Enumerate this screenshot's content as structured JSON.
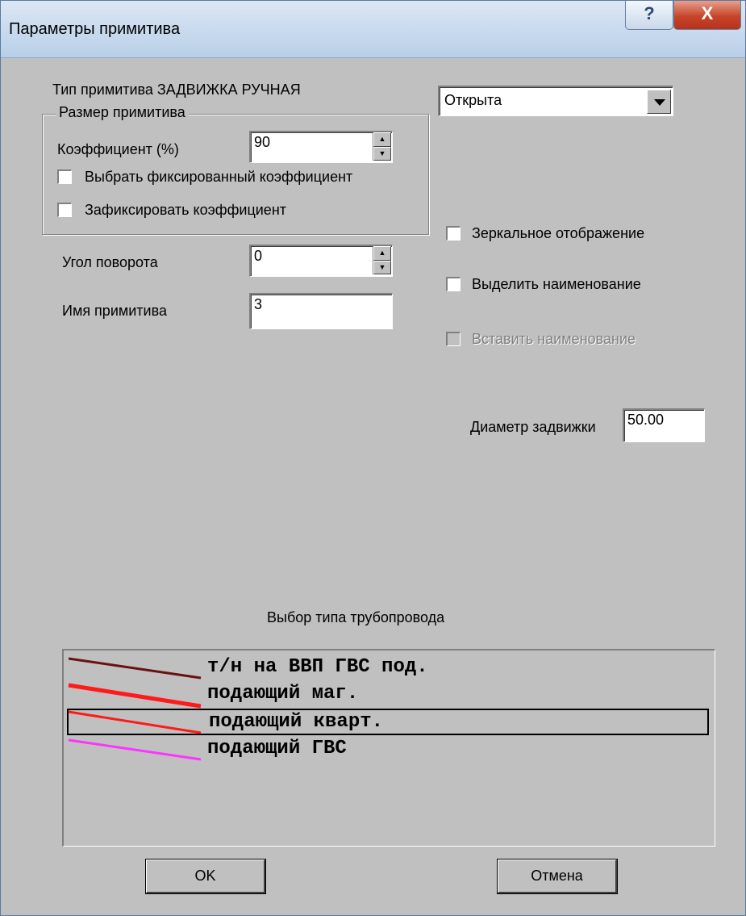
{
  "window": {
    "title": "Параметры примитива",
    "help_glyph": "?",
    "close_glyph": "X"
  },
  "primitive_type": "Тип примитива ЗАДВИЖКА РУЧНАЯ",
  "size_group": {
    "legend": "Размер примитива",
    "coeff_label": "Коэффициент (%)",
    "coeff_value": "90",
    "fixed_choice_label": "Выбрать фиксированный коэффициент",
    "fix_coeff_label": "Зафиксировать коэффициент"
  },
  "rotation": {
    "label": "Угол поворота",
    "value": "0"
  },
  "name": {
    "label": "Имя примитива",
    "value": "3"
  },
  "state_combo": {
    "selected": "Открыта"
  },
  "options": {
    "mirror": "Зеркальное отображение",
    "highlight_name": "Выделить наименование",
    "insert_name": "Вставить наименование"
  },
  "diameter": {
    "label": "Диаметр задвижки",
    "value": "50.00"
  },
  "pipeline": {
    "title": "Выбор типа трубопровода",
    "items": [
      {
        "label": "т/н на ВВП ГВС под.",
        "color": "#6b1010",
        "selected": false
      },
      {
        "label": "подающий маг.",
        "color": "#ff1a1a",
        "selected": false
      },
      {
        "label": "подающий кварт.",
        "color": "#ff1a1a",
        "selected": true
      },
      {
        "label": "подающий ГВС",
        "color": "#ff33ff",
        "selected": false
      }
    ]
  },
  "buttons": {
    "ok": "OK",
    "cancel": "Отмена"
  }
}
